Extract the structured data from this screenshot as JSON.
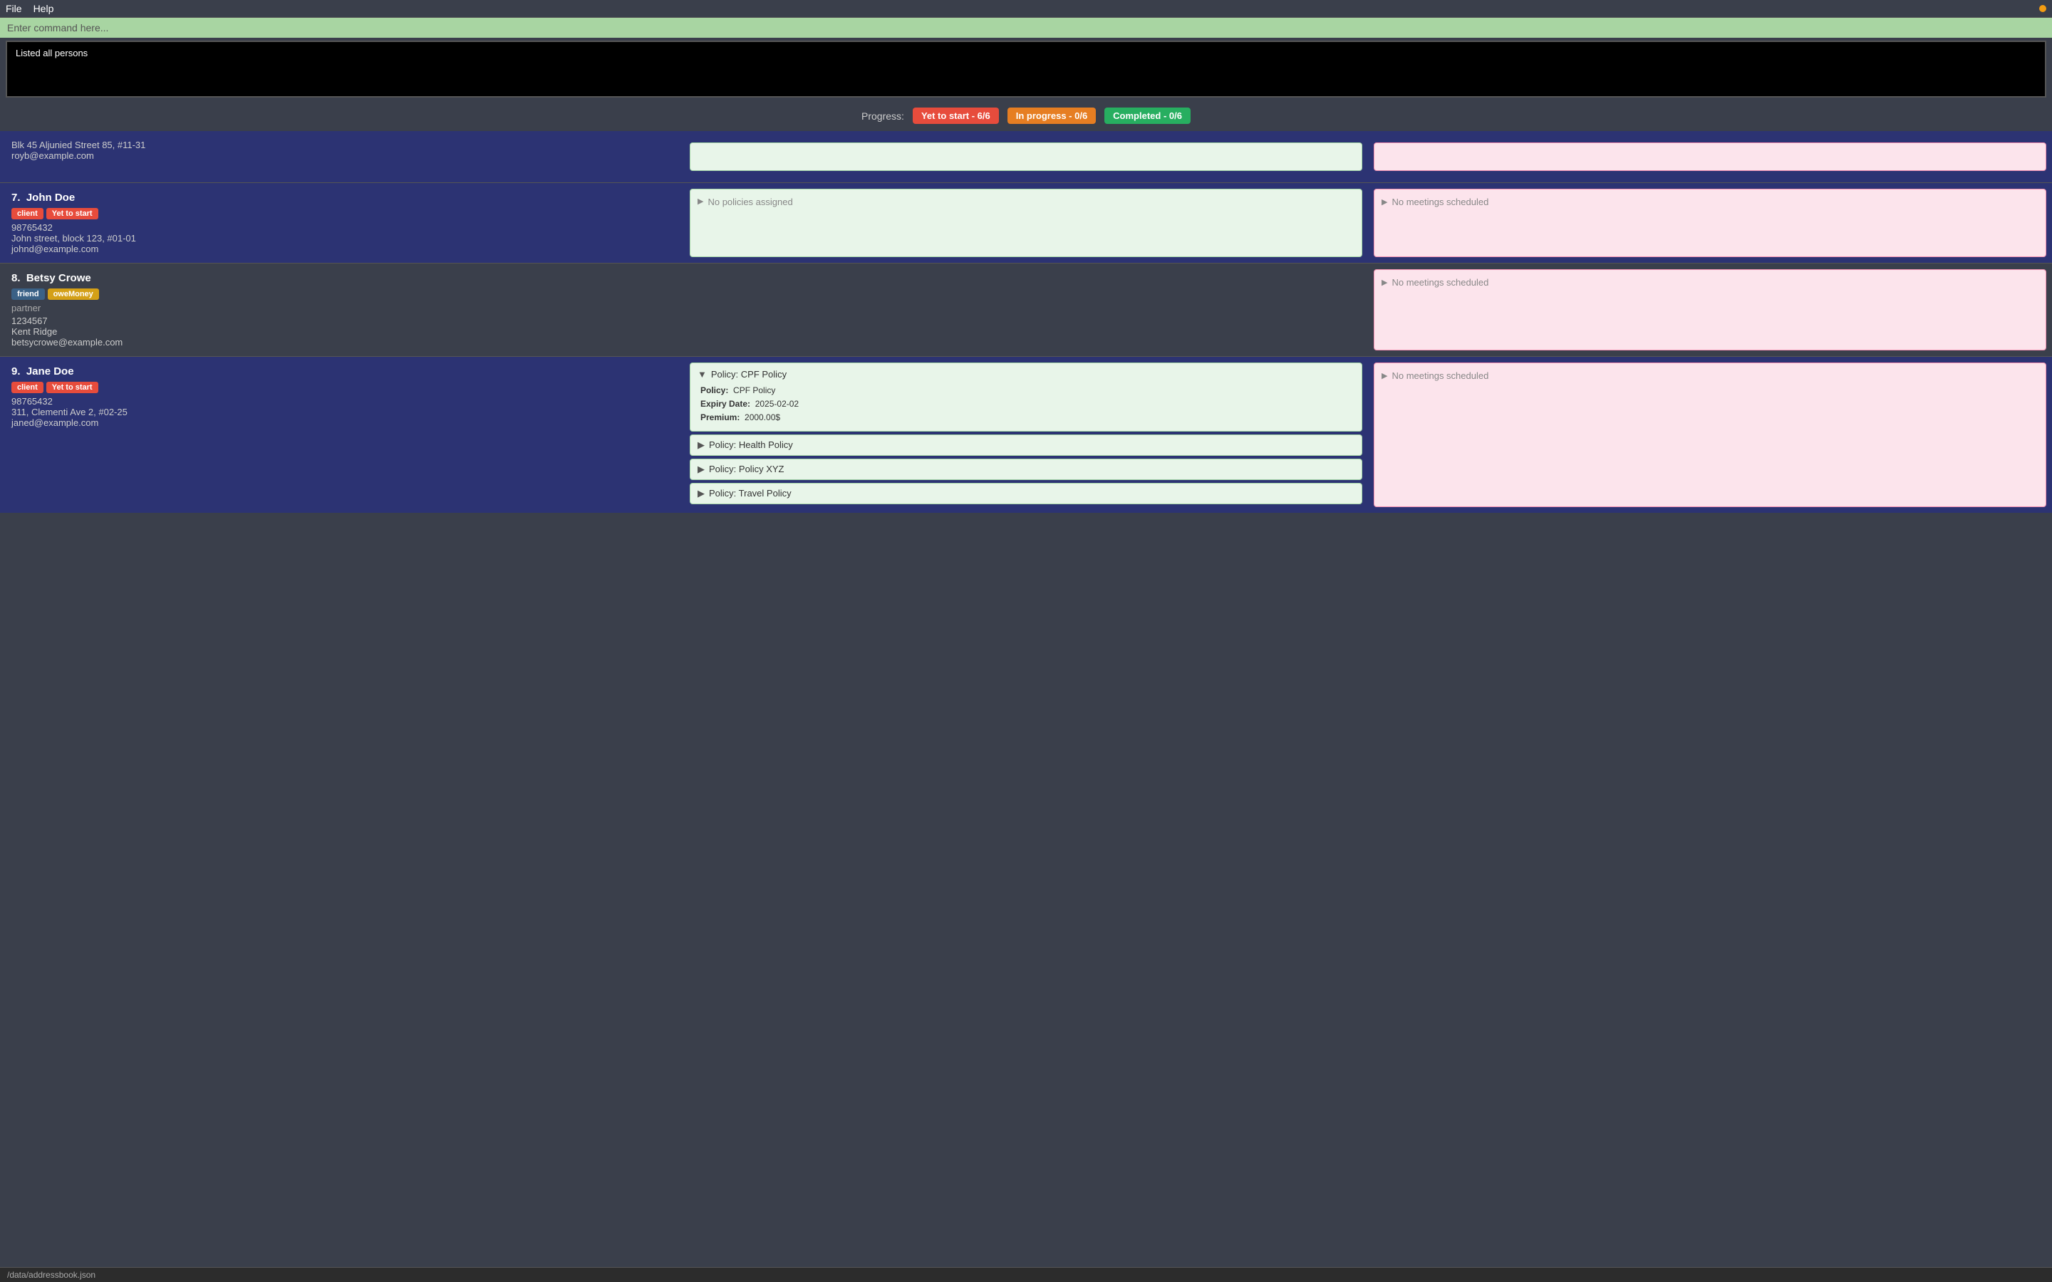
{
  "menubar": {
    "file_label": "File",
    "help_label": "Help"
  },
  "command": {
    "placeholder": "Enter command here...",
    "value": ""
  },
  "output": {
    "text": "Listed all persons"
  },
  "progress": {
    "label": "Progress:",
    "yet_to_start": "Yet to start - 6/6",
    "in_progress": "In progress - 0/6",
    "completed": "Completed - 0/6"
  },
  "partial_person": {
    "address": "Blk 45 Aljunied Street 85, #11-31",
    "email": "royb@example.com"
  },
  "persons": [
    {
      "index": "7.",
      "name": "John Doe",
      "tags": [
        {
          "label": "client",
          "type": "client"
        },
        {
          "label": "Yet to start",
          "type": "yet-to-start"
        }
      ],
      "phone": "98765432",
      "address": "John street, block 123, #01-01",
      "email": "johnd@example.com",
      "policies": [],
      "no_policies_text": "No policies assigned",
      "meetings": [],
      "no_meetings_text": "No meetings scheduled"
    },
    {
      "index": "8.",
      "name": "Betsy Crowe",
      "tags": [
        {
          "label": "friend",
          "type": "friend"
        },
        {
          "label": "oweMoney",
          "type": "owe-money"
        },
        {
          "label": "partner",
          "type": "partner"
        }
      ],
      "phone": "1234567",
      "address": "Kent Ridge",
      "email": "betsycrowe@example.com",
      "policies": null,
      "no_policies_text": null,
      "meetings": [],
      "no_meetings_text": "No meetings scheduled"
    },
    {
      "index": "9.",
      "name": "Jane Doe",
      "tags": [
        {
          "label": "client",
          "type": "client"
        },
        {
          "label": "Yet to start",
          "type": "yet-to-start"
        }
      ],
      "phone": "98765432",
      "address": "311, Clementi Ave 2, #02-25",
      "email": "janed@example.com",
      "policies": [
        {
          "title": "Policy: CPF Policy",
          "expanded": true,
          "details": {
            "policy": "CPF Policy",
            "expiry": "2025-02-02",
            "premium": "2000.00$"
          }
        },
        {
          "title": "Policy: Health Policy",
          "expanded": false
        },
        {
          "title": "Policy: Policy XYZ",
          "expanded": false
        },
        {
          "title": "Policy: Travel Policy",
          "expanded": false
        }
      ],
      "no_policies_text": null,
      "meetings": [],
      "no_meetings_text": "No meetings scheduled"
    }
  ],
  "status_bar": {
    "path": "/data/addressbook.json"
  }
}
